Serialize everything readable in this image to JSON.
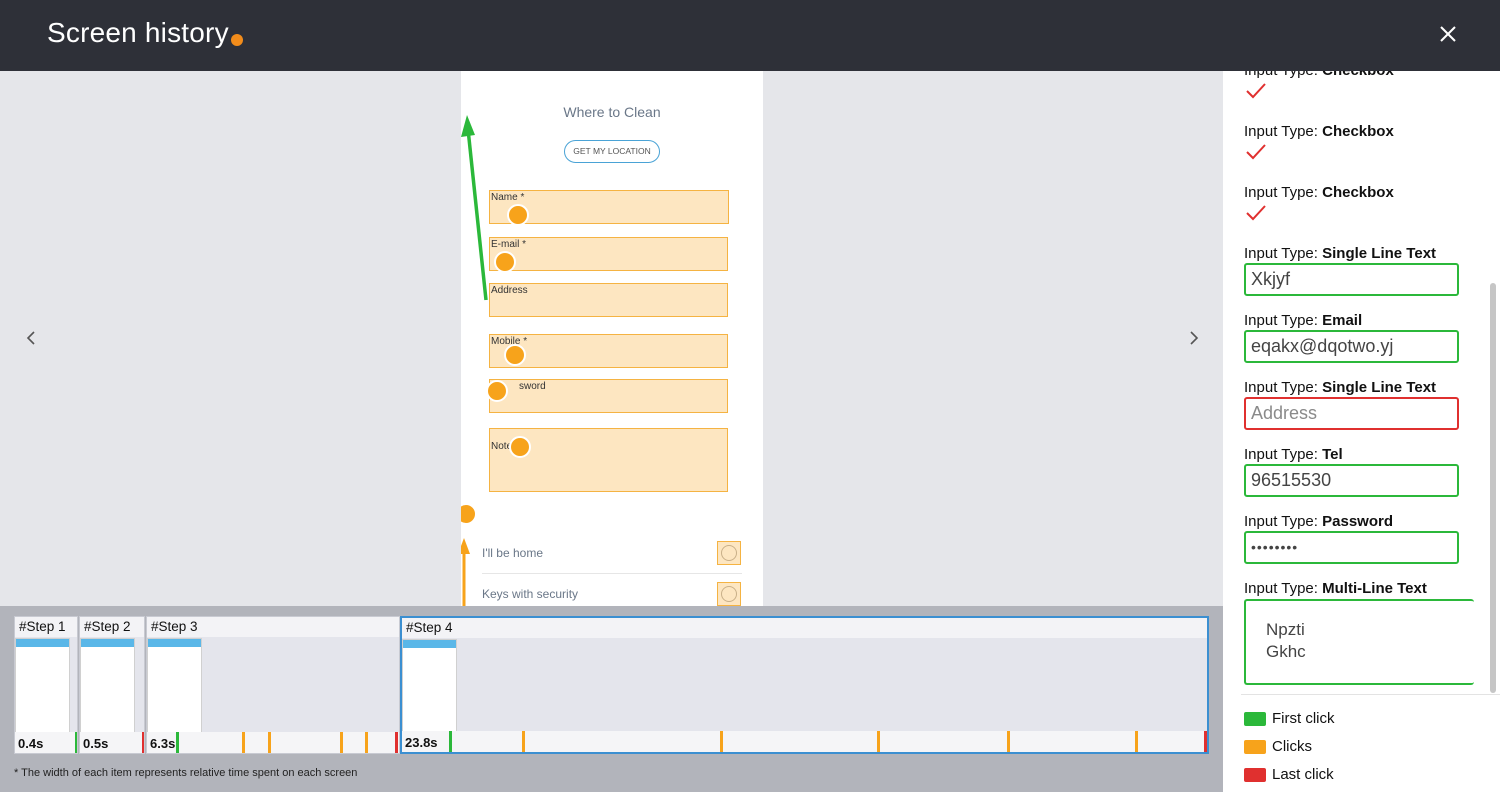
{
  "header": {
    "title": "Screen history",
    "accent_color": "#f28c1b",
    "close_icon": "close-icon"
  },
  "screen": {
    "title": "Where to Clean",
    "location_button": "GET MY LOCATION",
    "fields": [
      {
        "label": "Name *"
      },
      {
        "label": "E-mail *"
      },
      {
        "label": "Address"
      },
      {
        "label": "Mobile *"
      },
      {
        "label": "Password",
        "visible_label": "sword"
      },
      {
        "label": "Note",
        "visible_label": "Note"
      }
    ],
    "rows": [
      {
        "label": "I'll be home"
      },
      {
        "label": "Keys with security"
      }
    ]
  },
  "inputs": [
    {
      "type_prefix": "Input Type: ",
      "type": "Checkbox",
      "kind": "checkbox",
      "checked": true
    },
    {
      "type_prefix": "Input Type: ",
      "type": "Checkbox",
      "kind": "checkbox",
      "checked": true
    },
    {
      "type_prefix": "Input Type: ",
      "type": "Checkbox",
      "kind": "checkbox",
      "checked": true
    },
    {
      "type_prefix": "Input Type: ",
      "type": "Single Line Text",
      "kind": "text",
      "value": "Xkjyf",
      "status": "filled"
    },
    {
      "type_prefix": "Input Type: ",
      "type": "Email",
      "kind": "text",
      "value": "eqakx@dqotwo.yj",
      "status": "filled"
    },
    {
      "type_prefix": "Input Type: ",
      "type": "Single Line Text",
      "kind": "text",
      "value": "Address",
      "status": "empty"
    },
    {
      "type_prefix": "Input Type: ",
      "type": "Tel",
      "kind": "text",
      "value": "96515530",
      "status": "filled"
    },
    {
      "type_prefix": "Input Type: ",
      "type": "Password",
      "kind": "text",
      "value": "••••••••",
      "status": "filled"
    },
    {
      "type_prefix": "Input Type: ",
      "type": "Multi-Line Text",
      "kind": "textarea",
      "value": "Npzti\nGkhc",
      "status": "filled"
    }
  ],
  "legend": [
    {
      "label": "First click",
      "color": "#2bb83a"
    },
    {
      "label": "Clicks",
      "color": "#f7a31b"
    },
    {
      "label": "Last click",
      "color": "#e0302f"
    }
  ],
  "timeline": {
    "steps": [
      {
        "name": "#Step 1",
        "time": "0.4s",
        "active": false
      },
      {
        "name": "#Step 2",
        "time": "0.5s",
        "active": false
      },
      {
        "name": "#Step 3",
        "time": "6.3s",
        "active": false
      },
      {
        "name": "#Step 4",
        "time": "23.8s",
        "active": true
      }
    ],
    "footnote": "* The width of each item represents relative time spent on each screen"
  },
  "colors": {
    "first_click": "#2bb83a",
    "click": "#f7a31b",
    "last_click": "#e0302f",
    "active_step": "#3b8fd1"
  }
}
